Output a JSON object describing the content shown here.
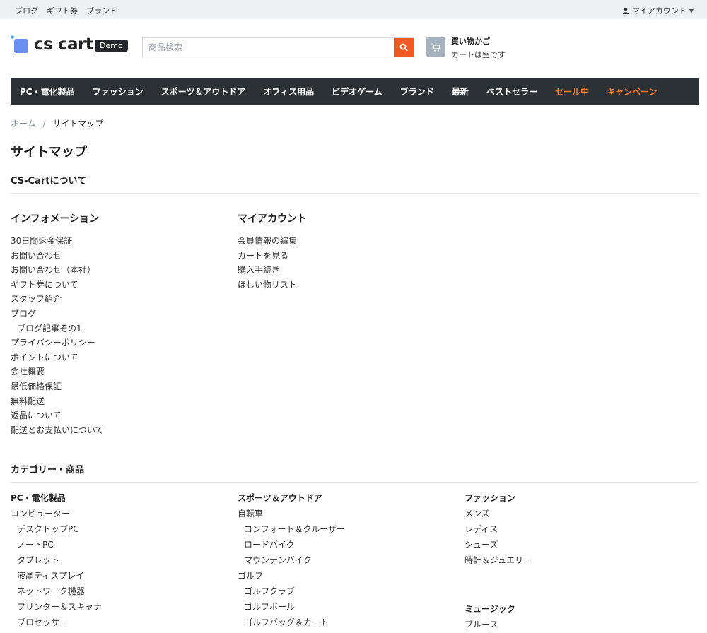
{
  "topbar": {
    "links": [
      "ブログ",
      "ギフト券",
      "ブランド"
    ],
    "account_label": "マイアカウント"
  },
  "header": {
    "logo_text": "cs cart",
    "badge": "Demo",
    "search_placeholder": "商品検索",
    "cart_title": "買い物かご",
    "cart_status": "カートは空です"
  },
  "nav": {
    "items": [
      {
        "label": "PC・電化製品",
        "hot": false
      },
      {
        "label": "ファッション",
        "hot": false
      },
      {
        "label": "スポーツ＆アウトドア",
        "hot": false
      },
      {
        "label": "オフィス用品",
        "hot": false
      },
      {
        "label": "ビデオゲーム",
        "hot": false
      },
      {
        "label": "ブランド",
        "hot": false
      },
      {
        "label": "最新",
        "hot": false
      },
      {
        "label": "ベストセラー",
        "hot": false
      },
      {
        "label": "セール中",
        "hot": true
      },
      {
        "label": "キャンペーン",
        "hot": true
      }
    ]
  },
  "breadcrumb": {
    "home": "ホーム",
    "separator": "/",
    "current": "サイトマップ"
  },
  "page_title": "サイトマップ",
  "about_section": "CS-Cartについて",
  "info": {
    "title": "インフォメーション",
    "items": [
      {
        "label": "30日間返金保証",
        "indent": false
      },
      {
        "label": "お問い合わせ",
        "indent": false
      },
      {
        "label": "お問い合わせ（本社）",
        "indent": false
      },
      {
        "label": "ギフト券について",
        "indent": false
      },
      {
        "label": "スタッフ紹介",
        "indent": false
      },
      {
        "label": "ブログ",
        "indent": false
      },
      {
        "label": "ブログ記事その1",
        "indent": true
      },
      {
        "label": "プライバシーポリシー",
        "indent": false
      },
      {
        "label": "ポイントについて",
        "indent": false
      },
      {
        "label": "会社概要",
        "indent": false
      },
      {
        "label": "最低価格保証",
        "indent": false
      },
      {
        "label": "無料配送",
        "indent": false
      },
      {
        "label": "返品について",
        "indent": false
      },
      {
        "label": "配送とお支払いについて",
        "indent": false
      }
    ]
  },
  "my_account": {
    "title": "マイアカウント",
    "items": [
      "会員情報の編集",
      "カートを見る",
      "購入手続き",
      "ほしい物リスト"
    ]
  },
  "categories_section": "カテゴリー・商品",
  "categories": {
    "pc": {
      "title": "PC・電化製品",
      "items": [
        {
          "label": "コンピューター",
          "indent": false
        },
        {
          "label": "デスクトップPC",
          "indent": true
        },
        {
          "label": "ノートPC",
          "indent": true
        },
        {
          "label": "タブレット",
          "indent": true
        },
        {
          "label": "液晶ディスプレイ",
          "indent": true
        },
        {
          "label": "ネットワーク機器",
          "indent": true
        },
        {
          "label": "プリンター＆スキャナ",
          "indent": true
        },
        {
          "label": "プロセッサー",
          "indent": true
        }
      ]
    },
    "sports": {
      "title": "スポーツ＆アウトドア",
      "items": [
        {
          "label": "自転車",
          "indent": false
        },
        {
          "label": "コンフォート＆クルーザー",
          "indent": true
        },
        {
          "label": "ロードバイク",
          "indent": true
        },
        {
          "label": "マウンテンバイク",
          "indent": true
        },
        {
          "label": "ゴルフ",
          "indent": false
        },
        {
          "label": "ゴルフクラブ",
          "indent": true
        },
        {
          "label": "ゴルフボール",
          "indent": true
        },
        {
          "label": "ゴルフバッグ＆カート",
          "indent": true
        }
      ]
    },
    "fashion": {
      "title": "ファッション",
      "items": [
        "メンズ",
        "レディス",
        "シューズ",
        "時計＆ジュエリー"
      ]
    },
    "music": {
      "title": "ミュージック",
      "items": [
        "ブルース"
      ]
    }
  },
  "colors": {
    "nav_bg": "#2c3135",
    "accent_orange": "#ef5a24",
    "hot_link": "#f77b2a"
  }
}
